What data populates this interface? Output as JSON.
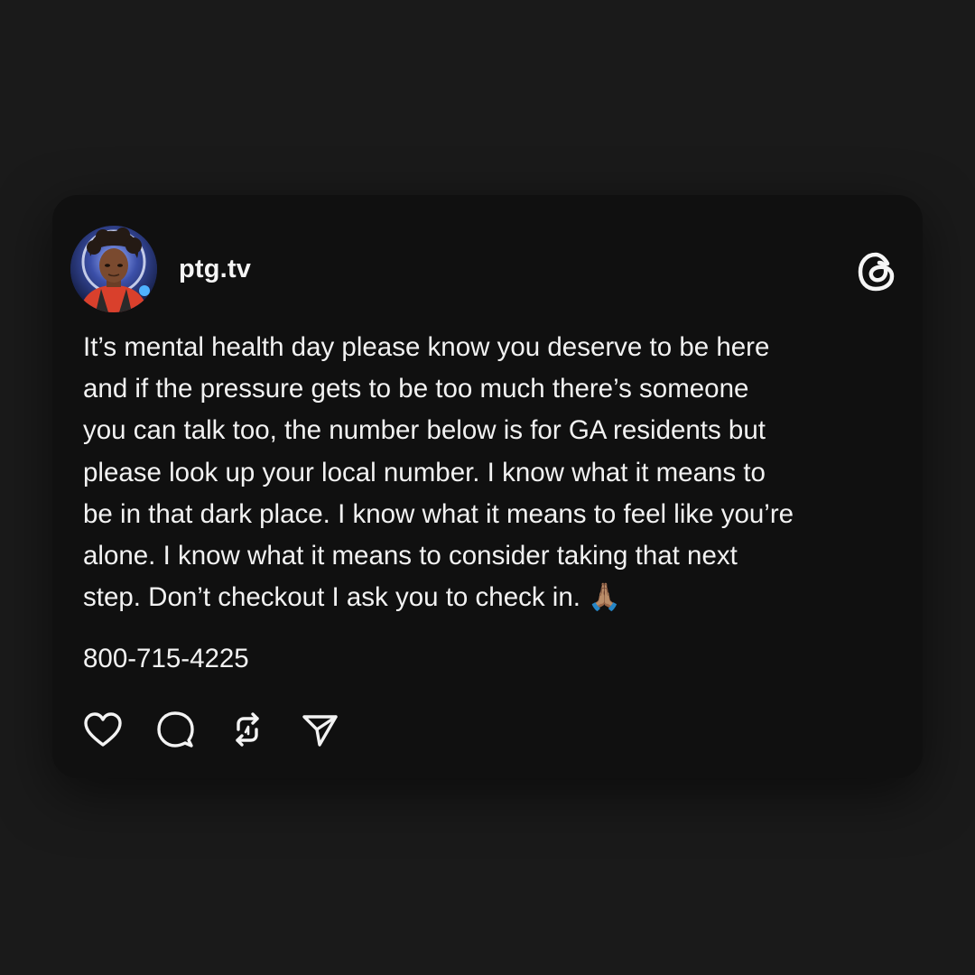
{
  "post": {
    "username": "ptg.tv",
    "text": "It’s mental health day please know you deserve to be here\nand if the pressure gets to be too much there’s someone\nyou can talk too, the number below is for GA residents but\nplease look up your local number.  I know what it means to\nbe in that dark place. I know what it means to feel like you’re\nalone. I know what it means to consider taking that next\nstep.  Don’t checkout I ask you to check in. 🙏🏽",
    "phone": "800-715-4225"
  },
  "icons": {
    "avatar": "profile-avatar",
    "logo": "threads-logo-icon",
    "like": "heart-icon",
    "comment": "comment-bubble-icon",
    "repost": "repost-icon",
    "share": "send-icon"
  },
  "colors": {
    "background": "#1a1a1a",
    "card": "#101010",
    "text": "#f2f2f2"
  }
}
